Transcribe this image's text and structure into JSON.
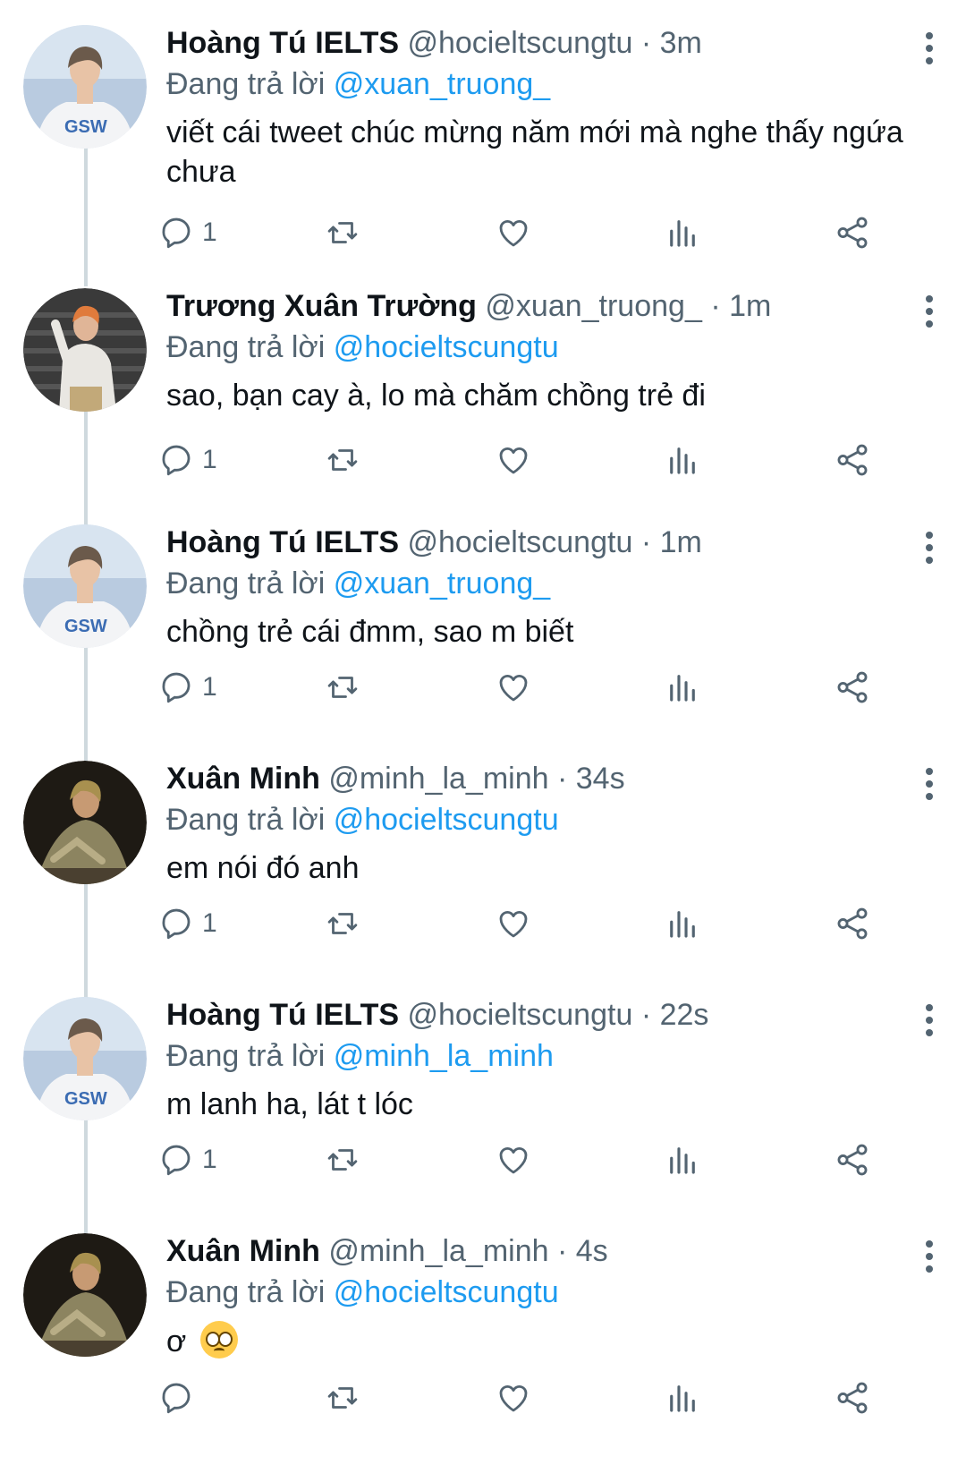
{
  "tweets": [
    {
      "name": "Hoàng Tú IELTS",
      "handle": "@hocieltscungtu",
      "separator": "·",
      "time": "3m",
      "reply_prefix": "Đang trả lời",
      "reply_to": "@xuan_truong_",
      "text": "viết cái tweet chúc mừng năm mới mà nghe thấy ngứa chưa",
      "reply_count": "1",
      "avatar": "avatar-gsw-shirt"
    },
    {
      "name": "Trương Xuân Trường",
      "handle": "@xuan_truong_",
      "separator": "·",
      "time": "1m",
      "reply_prefix": "Đang trả lời",
      "reply_to": "@hocieltscungtu",
      "text": "sao, bạn cay à, lo mà chăm chồng trẻ đi",
      "reply_count": "1",
      "avatar": "avatar-orange-hair"
    },
    {
      "name": "Hoàng Tú IELTS",
      "handle": "@hocieltscungtu",
      "separator": "·",
      "time": "1m",
      "reply_prefix": "Đang trả lời",
      "reply_to": "@xuan_truong_",
      "text": "chồng trẻ cái đmm, sao m biết",
      "reply_count": "1",
      "avatar": "avatar-gsw-shirt"
    },
    {
      "name": "Xuân Minh",
      "handle": "@minh_la_minh",
      "separator": "·",
      "time": "34s",
      "reply_prefix": "Đang trả lời",
      "reply_to": "@hocieltscungtu",
      "text": "em nói đó anh",
      "reply_count": "1",
      "avatar": "avatar-dark-jacket"
    },
    {
      "name": "Hoàng Tú IELTS",
      "handle": "@hocieltscungtu",
      "separator": "·",
      "time": "22s",
      "reply_prefix": "Đang trả lời",
      "reply_to": "@minh_la_minh",
      "text": "m lanh ha, lát t lóc",
      "reply_count": "1",
      "avatar": "avatar-gsw-shirt"
    },
    {
      "name": "Xuân Minh",
      "handle": "@minh_la_minh",
      "separator": "·",
      "time": "4s",
      "reply_prefix": "Đang trả lời",
      "reply_to": "@hocieltscungtu",
      "text": "ơ",
      "text_emoji": "pleading-face-emoji",
      "reply_count": "",
      "avatar": "avatar-dark-jacket"
    }
  ],
  "colors": {
    "mention": "#1d9bf0",
    "secondary_text": "#536471",
    "primary_text": "#0f1419",
    "thread_line": "#cfd9de"
  },
  "icons": [
    "reply-icon",
    "retweet-icon",
    "like-icon",
    "views-icon",
    "share-icon",
    "more-options-icon"
  ]
}
